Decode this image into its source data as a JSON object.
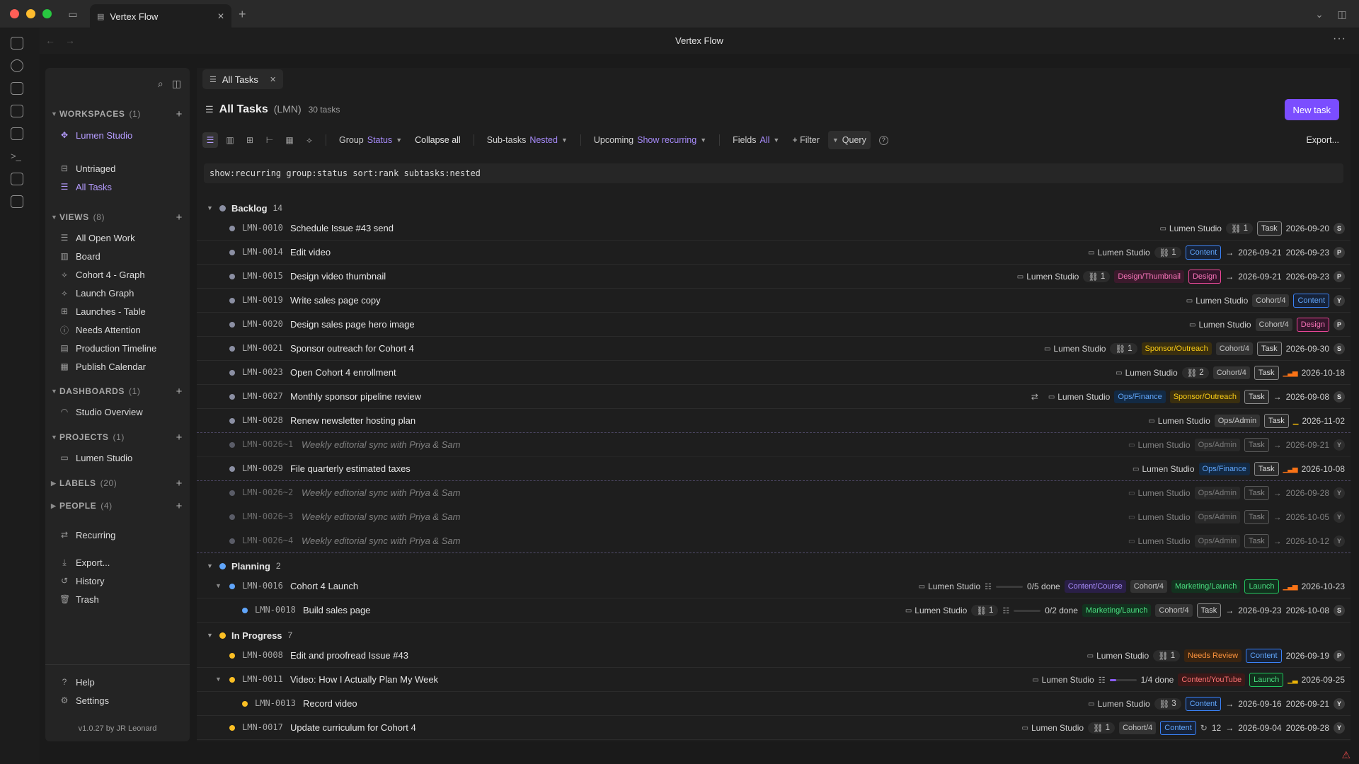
{
  "browser": {
    "tab_title": "Vertex Flow",
    "app_title": "Vertex Flow"
  },
  "sidebar": {
    "workspaces": {
      "label": "WORKSPACES",
      "count": "(1)"
    },
    "workspace_name": "Lumen Studio",
    "untriaged": "Untriaged",
    "all_tasks": "All Tasks",
    "views": {
      "label": "VIEWS",
      "count": "(8)"
    },
    "view_items": [
      "All Open Work",
      "Board",
      "Cohort 4 - Graph",
      "Launch Graph",
      "Launches - Table",
      "Needs Attention",
      "Production Timeline",
      "Publish Calendar"
    ],
    "dashboards": {
      "label": "DASHBOARDS",
      "count": "(1)"
    },
    "dashboard_items": [
      "Studio Overview"
    ],
    "projects": {
      "label": "PROJECTS",
      "count": "(1)"
    },
    "project_items": [
      "Lumen Studio"
    ],
    "labels": {
      "label": "LABELS",
      "count": "(20)"
    },
    "people": {
      "label": "PEOPLE",
      "count": "(4)"
    },
    "recurring": "Recurring",
    "export": "Export...",
    "history": "History",
    "trash": "Trash",
    "help": "Help",
    "settings": "Settings",
    "version": "v1.0.27 by JR Leonard"
  },
  "main": {
    "tab_label": "All Tasks",
    "title": "All Tasks",
    "code": "(LMN)",
    "count": "30 tasks",
    "new_task": "New task",
    "toolbar": {
      "group_label": "Group",
      "group_value": "Status",
      "collapse_all": "Collapse all",
      "subtasks_label": "Sub-tasks",
      "subtasks_value": "Nested",
      "upcoming_label": "Upcoming",
      "upcoming_value": "Show recurring",
      "fields_label": "Fields",
      "fields_value": "All",
      "filter": "+ Filter",
      "query": "Query",
      "export": "Export..."
    },
    "query": "show:recurring group:status sort:rank subtasks:nested"
  },
  "groups": [
    {
      "name": "Backlog",
      "count": "14",
      "color": "#8b8fa3"
    },
    {
      "name": "Planning",
      "count": "2",
      "color": "#60a5fa"
    },
    {
      "name": "In Progress",
      "count": "7",
      "color": "#fbbf24"
    }
  ],
  "tasks": {
    "r0": {
      "id": "LMN-0010",
      "title": "Schedule Issue #43 send",
      "project": "Lumen Studio",
      "links": "1",
      "type": "Task",
      "date": "2026-09-20",
      "avatar": "S"
    },
    "r1": {
      "id": "LMN-0014",
      "title": "Edit video",
      "project": "Lumen Studio",
      "links": "1",
      "type": "Content",
      "start": "2026-09-21",
      "due": "2026-09-23",
      "avatar": "P"
    },
    "r2": {
      "id": "LMN-0015",
      "title": "Design video thumbnail",
      "project": "Lumen Studio",
      "links": "1",
      "label": "Design/Thumbnail",
      "type": "Design",
      "start": "2026-09-21",
      "due": "2026-09-23",
      "avatar": "P"
    },
    "r3": {
      "id": "LMN-0019",
      "title": "Write sales page copy",
      "project": "Lumen Studio",
      "label": "Cohort/4",
      "type": "Content",
      "avatar": "Y"
    },
    "r4": {
      "id": "LMN-0020",
      "title": "Design sales page hero image",
      "project": "Lumen Studio",
      "label": "Cohort/4",
      "type": "Design",
      "avatar": "P"
    },
    "r5": {
      "id": "LMN-0021",
      "title": "Sponsor outreach for Cohort 4",
      "project": "Lumen Studio",
      "links": "1",
      "label": "Sponsor/Outreach",
      "label2": "Cohort/4",
      "type": "Task",
      "date": "2026-09-30",
      "avatar": "S"
    },
    "r6": {
      "id": "LMN-0023",
      "title": "Open Cohort 4 enrollment",
      "project": "Lumen Studio",
      "links": "2",
      "label": "Cohort/4",
      "type": "Task",
      "date": "2026-10-18"
    },
    "r7": {
      "id": "LMN-0027",
      "title": "Monthly sponsor pipeline review",
      "project": "Lumen Studio",
      "label": "Ops/Finance",
      "label2": "Sponsor/Outreach",
      "type": "Task",
      "date": "2026-09-08",
      "avatar": "S"
    },
    "r8": {
      "id": "LMN-0028",
      "title": "Renew newsletter hosting plan",
      "project": "Lumen Studio",
      "label": "Ops/Admin",
      "type": "Task",
      "date": "2026-11-02"
    },
    "r9": {
      "id": "LMN-0026~1",
      "title": "Weekly editorial sync with Priya & Sam",
      "project": "Lumen Studio",
      "label": "Ops/Admin",
      "type": "Task",
      "date": "2026-09-21",
      "avatar": "Y"
    },
    "r10": {
      "id": "LMN-0029",
      "title": "File quarterly estimated taxes",
      "project": "Lumen Studio",
      "label": "Ops/Finance",
      "type": "Task",
      "date": "2026-10-08"
    },
    "r11": {
      "id": "LMN-0026~2",
      "title": "Weekly editorial sync with Priya & Sam",
      "project": "Lumen Studio",
      "label": "Ops/Admin",
      "type": "Task",
      "date": "2026-09-28",
      "avatar": "Y"
    },
    "r12": {
      "id": "LMN-0026~3",
      "title": "Weekly editorial sync with Priya & Sam",
      "project": "Lumen Studio",
      "label": "Ops/Admin",
      "type": "Task",
      "date": "2026-10-05",
      "avatar": "Y"
    },
    "r13": {
      "id": "LMN-0026~4",
      "title": "Weekly editorial sync with Priya & Sam",
      "project": "Lumen Studio",
      "label": "Ops/Admin",
      "type": "Task",
      "date": "2026-10-12",
      "avatar": "Y"
    },
    "r14": {
      "id": "LMN-0016",
      "title": "Cohort 4 Launch",
      "project": "Lumen Studio",
      "progress": "0/5 done",
      "progress_fraction": 0,
      "label": "Content/Course",
      "label2": "Cohort/4",
      "label3": "Marketing/Launch",
      "type": "Launch",
      "date": "2026-10-23"
    },
    "r15": {
      "id": "LMN-0018",
      "title": "Build sales page",
      "project": "Lumen Studio",
      "links": "1",
      "progress": "0/2 done",
      "progress_fraction": 0,
      "label": "Marketing/Launch",
      "label2": "Cohort/4",
      "type": "Task",
      "start": "2026-09-23",
      "due": "2026-10-08",
      "avatar": "S"
    },
    "r16": {
      "id": "LMN-0008",
      "title": "Edit and proofread Issue #43",
      "project": "Lumen Studio",
      "links": "1",
      "label": "Needs Review",
      "type": "Content",
      "date": "2026-09-19",
      "avatar": "P"
    },
    "r17": {
      "id": "LMN-0011",
      "title": "Video: How I Actually Plan My Week",
      "project": "Lumen Studio",
      "progress": "1/4 done",
      "progress_fraction": 0.25,
      "label": "Content/YouTube",
      "type": "Launch",
      "date": "2026-09-25"
    },
    "r18": {
      "id": "LMN-0013",
      "title": "Record video",
      "project": "Lumen Studio",
      "links": "3",
      "type": "Content",
      "start": "2026-09-16",
      "due": "2026-09-21",
      "avatar": "Y"
    },
    "r19": {
      "id": "LMN-0017",
      "title": "Update curriculum for Cohort 4",
      "project": "Lumen Studio",
      "links": "1",
      "label": "Cohort/4",
      "type": "Content",
      "recur": "12",
      "start": "2026-09-04",
      "due": "2026-09-28",
      "avatar": "Y"
    }
  }
}
